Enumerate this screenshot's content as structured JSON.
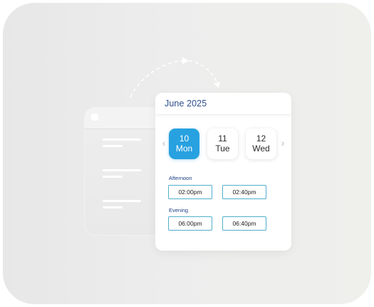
{
  "calendar": {
    "title": "June 2025",
    "days": [
      {
        "num": "10",
        "weekday": "Mon",
        "selected": true
      },
      {
        "num": "11",
        "weekday": "Tue",
        "selected": false
      },
      {
        "num": "12",
        "weekday": "Wed",
        "selected": false
      }
    ],
    "sections": [
      {
        "label": "Afternoon",
        "slots": [
          "02:00pm",
          "02:40pm"
        ]
      },
      {
        "label": "Evening",
        "slots": [
          "06:00pm",
          "06:40pm"
        ]
      }
    ]
  },
  "icons": {
    "prev": "chevron-left-icon",
    "next": "chevron-right-icon",
    "arrow": "dashed-arrow-icon"
  },
  "colors": {
    "accent": "#28a1e0",
    "title": "#2f4e8d",
    "slot_border": "#52aecd"
  }
}
